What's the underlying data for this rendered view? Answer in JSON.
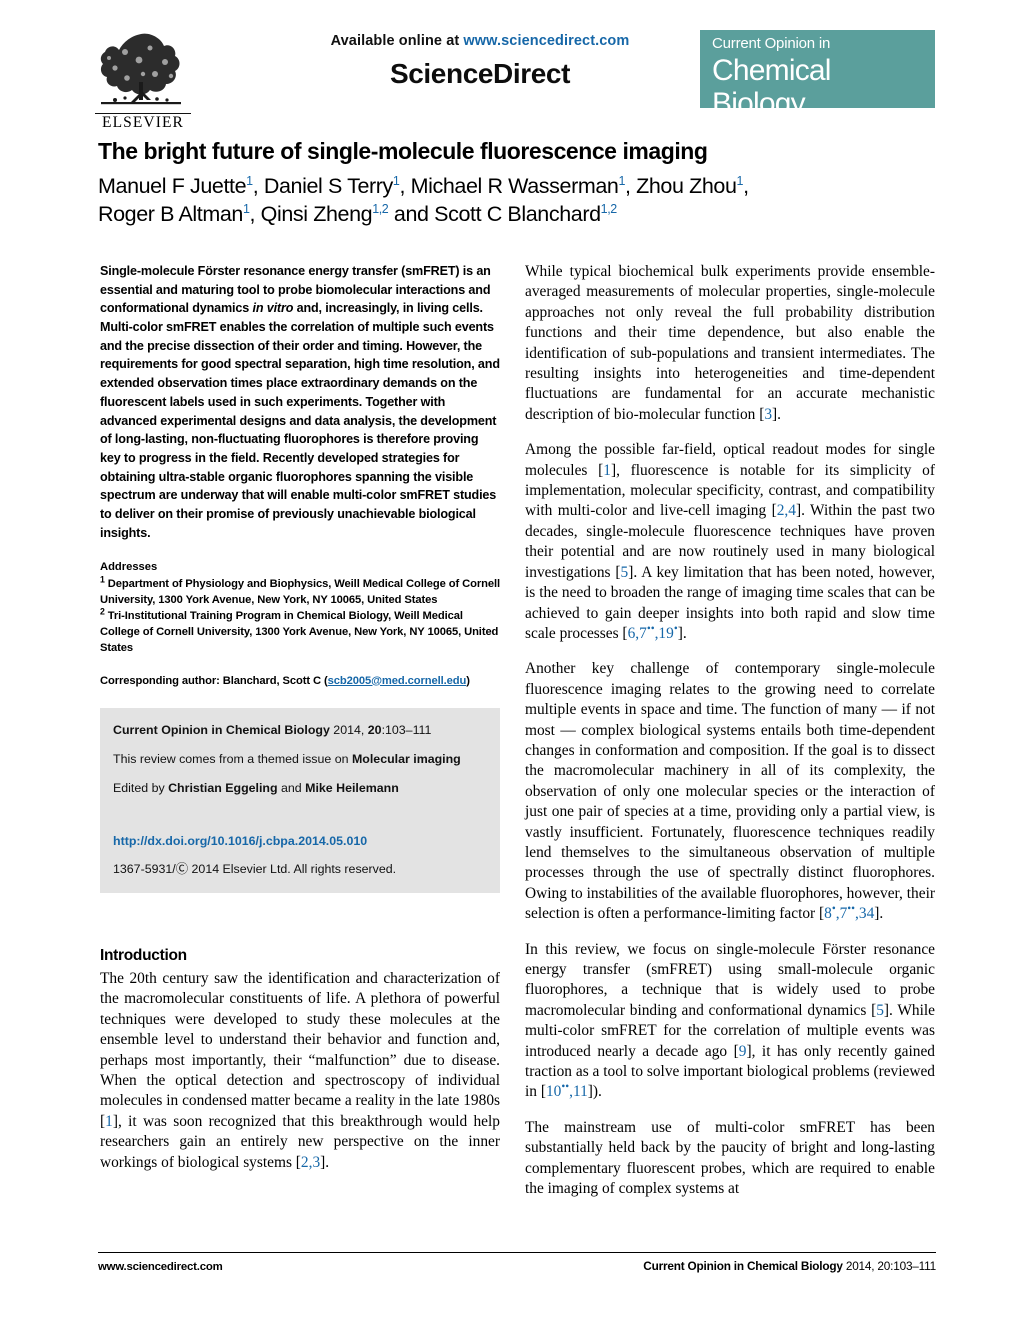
{
  "masthead": {
    "available_prefix": "Available online at ",
    "available_url": "www.sciencedirect.com",
    "sciencedirect": "ScienceDirect",
    "elsevier_wordmark": "ELSEVIER",
    "journal_badge_line1": "Current Opinion in",
    "journal_badge_line2": "Chemical Biology",
    "badge_color": "#5b9f9c",
    "link_color": "#1667a8"
  },
  "article": {
    "title": "The bright future of single-molecule fluorescence imaging",
    "authors_line1_a": "Manuel F Juette",
    "authors_line1_b": ", Daniel S Terry",
    "authors_line1_c": ", Michael R Wasserman",
    "authors_line1_d": ", Zhou Zhou",
    "authors_line2_a": "Roger B Altman",
    "authors_line2_b": ", Qinsi Zheng",
    "authors_line2_c": " and Scott C Blanchard",
    "sup1": "1",
    "sup12": "1,2"
  },
  "abstract": {
    "text": "Single-molecule Förster resonance energy transfer (smFRET) is an essential and maturing tool to probe biomolecular interactions and conformational dynamics ",
    "italic": "in vitro",
    "text2": " and, increasingly, in living cells. Multi-color smFRET enables the correlation of multiple such events and the precise dissection of their order and timing. However, the requirements for good spectral separation, high time resolution, and extended observation times place extraordinary demands on the fluorescent labels used in such experiments. Together with advanced experimental designs and data analysis, the development of long-lasting, non-fluctuating fluorophores is therefore proving key to progress in the field. Recently developed strategies for obtaining ultra-stable organic fluorophores spanning the visible spectrum are underway that will enable multi-color smFRET studies to deliver on their promise of previously unachievable biological insights."
  },
  "addresses": {
    "heading": "Addresses",
    "items": [
      {
        "marker": "1",
        "text": "Department of Physiology and Biophysics, Weill Medical College of Cornell University, 1300 York Avenue, New York, NY 10065, United States"
      },
      {
        "marker": "2",
        "text": "Tri-Institutional Training Program in Chemical Biology, Weill Medical College of Cornell University, 1300 York Avenue, New York, NY 10065, United States"
      }
    ],
    "corresponding_prefix": "Corresponding author: Blanchard, Scott C (",
    "corresponding_email": "scb2005@med.cornell.edu",
    "corresponding_suffix": ")"
  },
  "grey_box": {
    "journal_name": "Current Opinion in Chemical Biology",
    "citation_year_vol": " 2014, ",
    "citation_volume": "20",
    "citation_pages": ":103–111",
    "themed_prefix": "This review comes from a themed issue on ",
    "themed_topic": "Molecular imaging",
    "edited_prefix": "Edited by ",
    "editor_1": "Christian Eggeling",
    "edited_and": " and ",
    "editor_2": "Mike Heilemann",
    "doi": "http://dx.doi.org/10.1016/j.cbpa.2014.05.010",
    "copyright": "1367-5931/Ⓒ 2014 Elsevier Ltd. All rights reserved."
  },
  "introduction": {
    "heading": "Introduction",
    "paragraph_1_a": "The 20th century saw the identification and characterization of the macromolecular constituents of life. A plethora of powerful techniques were developed to study these molecules at the ensemble level to understand their behavior and function and, perhaps most importantly, their “malfunction” due to disease. When the optical detection and spectroscopy of individual molecules in condensed matter became a reality in the late 1980s [",
    "paragraph_1_ref1": "1",
    "paragraph_1_b": "], it was soon recognized that this breakthrough would help researchers gain an entirely new perspective on the inner workings of biological systems [",
    "paragraph_1_ref2": "2,3",
    "paragraph_1_c": "]."
  },
  "right_column": {
    "p1_a": "While typical biochemical bulk experiments provide ensemble-averaged measurements of molecular properties, single-molecule approaches not only reveal the full probability distribution functions and their time dependence, but also enable the identification of sub-populations and transient intermediates. The resulting insights into heterogeneities and time-dependent fluctuations are fundamental for an accurate mechanistic description of bio-molecular function [",
    "p1_ref": "3",
    "p1_b": "].",
    "p2_a": "Among the possible far-field, optical readout modes for single molecules [",
    "p2_ref1": "1",
    "p2_b": "], fluorescence is notable for its simplicity of implementation, molecular specificity, contrast, and compatibility with multi-color and live-cell imaging [",
    "p2_ref2": "2,4",
    "p2_c": "]. Within the past two decades, single-molecule fluorescence techniques have proven their potential and are now routinely used in many biological investigations [",
    "p2_ref3": "5",
    "p2_d": "]. A key limitation that has been noted, however, is the need to broaden the range of imaging time scales that can be achieved to gain deeper insights into both rapid and slow time scale processes [",
    "p2_ref4a": "6,7",
    "p2_ref4a_sup": "••",
    "p2_ref4b": ",19",
    "p2_ref4b_sup": "•",
    "p2_e": "].",
    "p3": "Another key challenge of contemporary single-molecule fluorescence imaging relates to the growing need to correlate multiple events in space and time. The function of many — if not most — complex biological systems entails both time-dependent changes in conformation and composition. If the goal is to dissect the macromolecular machinery in all of its complexity, the observation of only one molecular species or the interaction of just one pair of species at a time, providing only a partial view, is vastly insufficient. Fortunately, fluorescence techniques readily lend themselves to the simultaneous observation of multiple processes through the use of spectrally distinct fluorophores. Owing to instabilities of the available fluorophores, however, their selection is often a performance-limiting factor [",
    "p3_ref_a": "8",
    "p3_ref_a_sup": "•",
    "p3_ref_b": ",7",
    "p3_ref_b_sup": "••",
    "p3_ref_c": ",34",
    "p3_end": "].",
    "p4_a": "In this review, we focus on single-molecule Förster resonance energy transfer (smFRET) using small-molecule organic fluorophores, a technique that is widely used to probe macromolecular binding and conformational dynamics [",
    "p4_ref1": "5",
    "p4_b": "]. While multi-color smFRET for the correlation of multiple events was introduced nearly a decade ago [",
    "p4_ref2": "9",
    "p4_c": "], it has only recently gained traction as a tool to solve important biological problems (reviewed in [",
    "p4_ref3": "10",
    "p4_ref3_sup": "••",
    "p4_ref4": ",11",
    "p4_d": "]).",
    "p5": "The mainstream use of multi-color smFRET has been substantially held back by the paucity of bright and long-lasting complementary fluorescent probes, which are required to enable the imaging of complex systems at"
  },
  "footer": {
    "left": "www.sciencedirect.com",
    "right_journal": "Current Opinion in Chemical Biology",
    "right_rest": " 2014, 20:103–111"
  }
}
